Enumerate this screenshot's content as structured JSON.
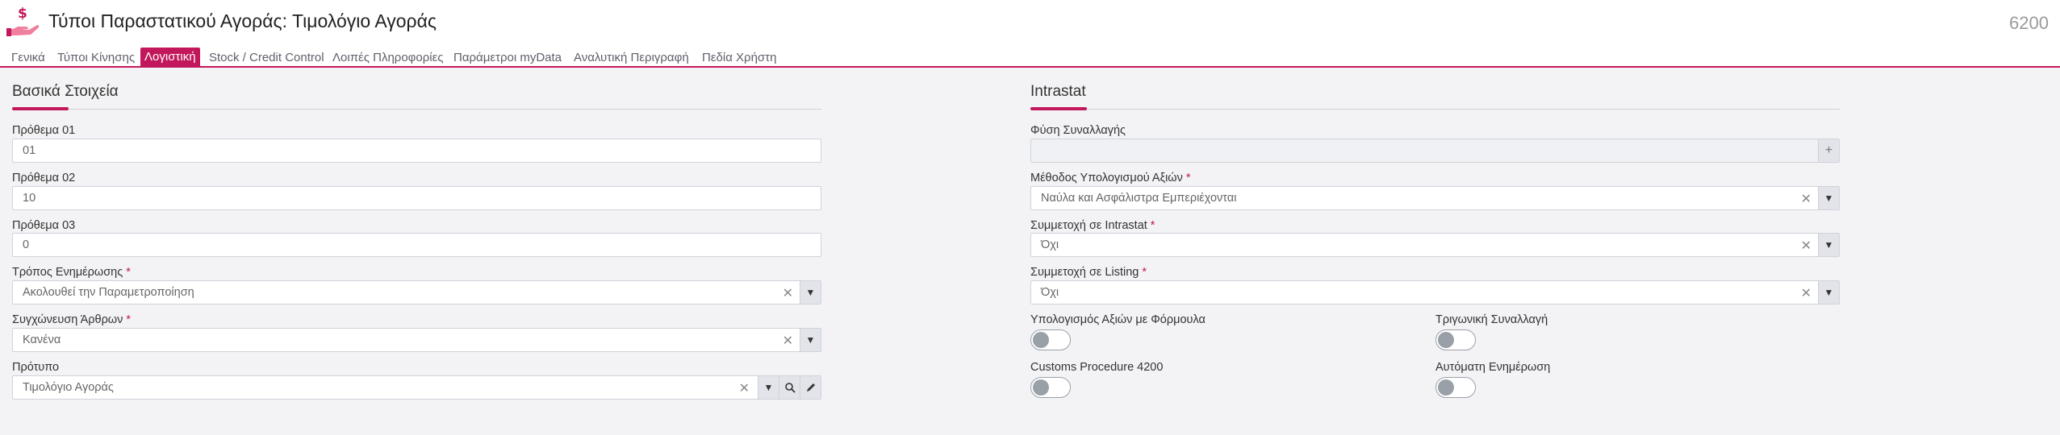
{
  "header": {
    "title": "Τύποι Παραστατικού Αγοράς: Τιμολόγιο Αγοράς",
    "record_number": "6200",
    "icon": "hand-dollar-icon",
    "accent_color": "#c2185b"
  },
  "tabs": [
    {
      "label": "Γενικά",
      "active": false
    },
    {
      "label": "Τύποι Κίνησης",
      "active": false
    },
    {
      "label": "Λογιστική",
      "active": true
    },
    {
      "label": "Stock / Credit Control",
      "active": false
    },
    {
      "label": "Λοιπές Πληροφορίες",
      "active": false
    },
    {
      "label": "Παράμετροι myData",
      "active": false
    },
    {
      "label": "Αναλυτική Περιγραφή",
      "active": false
    },
    {
      "label": "Πεδία Χρήστη",
      "active": false
    }
  ],
  "basic": {
    "title": "Βασικά Στοιχεία",
    "prefix1": {
      "label": "Πρόθεμα 01",
      "value": "01"
    },
    "prefix2": {
      "label": "Πρόθεμα 02",
      "value": "10"
    },
    "prefix3": {
      "label": "Πρόθεμα 03",
      "value": "0"
    },
    "update_mode": {
      "label": "Τρόπος Ενημέρωσης",
      "required": "*",
      "value": "Ακολουθεί την Παραμετροποίηση"
    },
    "merge_items": {
      "label": "Συγχώνευση Άρθρων",
      "required": "*",
      "value": "Κανένα"
    },
    "template": {
      "label": "Πρότυπο",
      "value": "Τιμολόγιο Αγοράς"
    }
  },
  "intrastat": {
    "title": "Intrastat",
    "transaction_nature": {
      "label": "Φύση Συναλλαγής",
      "value": ""
    },
    "value_method": {
      "label": "Μέθοδος Υπολογισμού Αξιών",
      "required": "*",
      "value": "Ναύλα και Ασφάλιστρα Εμπεριέχονται"
    },
    "participation_intrastat": {
      "label": "Συμμετοχή σε Intrastat",
      "required": "*",
      "value": "Όχι"
    },
    "participation_listing": {
      "label": "Συμμετοχή σε Listing",
      "required": "*",
      "value": "Όχι"
    },
    "formula_calc": {
      "label": "Υπολογισμός Αξιών με Φόρμουλα",
      "on": false
    },
    "triangular": {
      "label": "Τριγωνική Συναλλαγή",
      "on": false
    },
    "customs_procedure": {
      "label": "Customs Procedure 4200",
      "on": false
    },
    "auto_update": {
      "label": "Αυτόματη Ενημέρωση",
      "on": false
    }
  }
}
